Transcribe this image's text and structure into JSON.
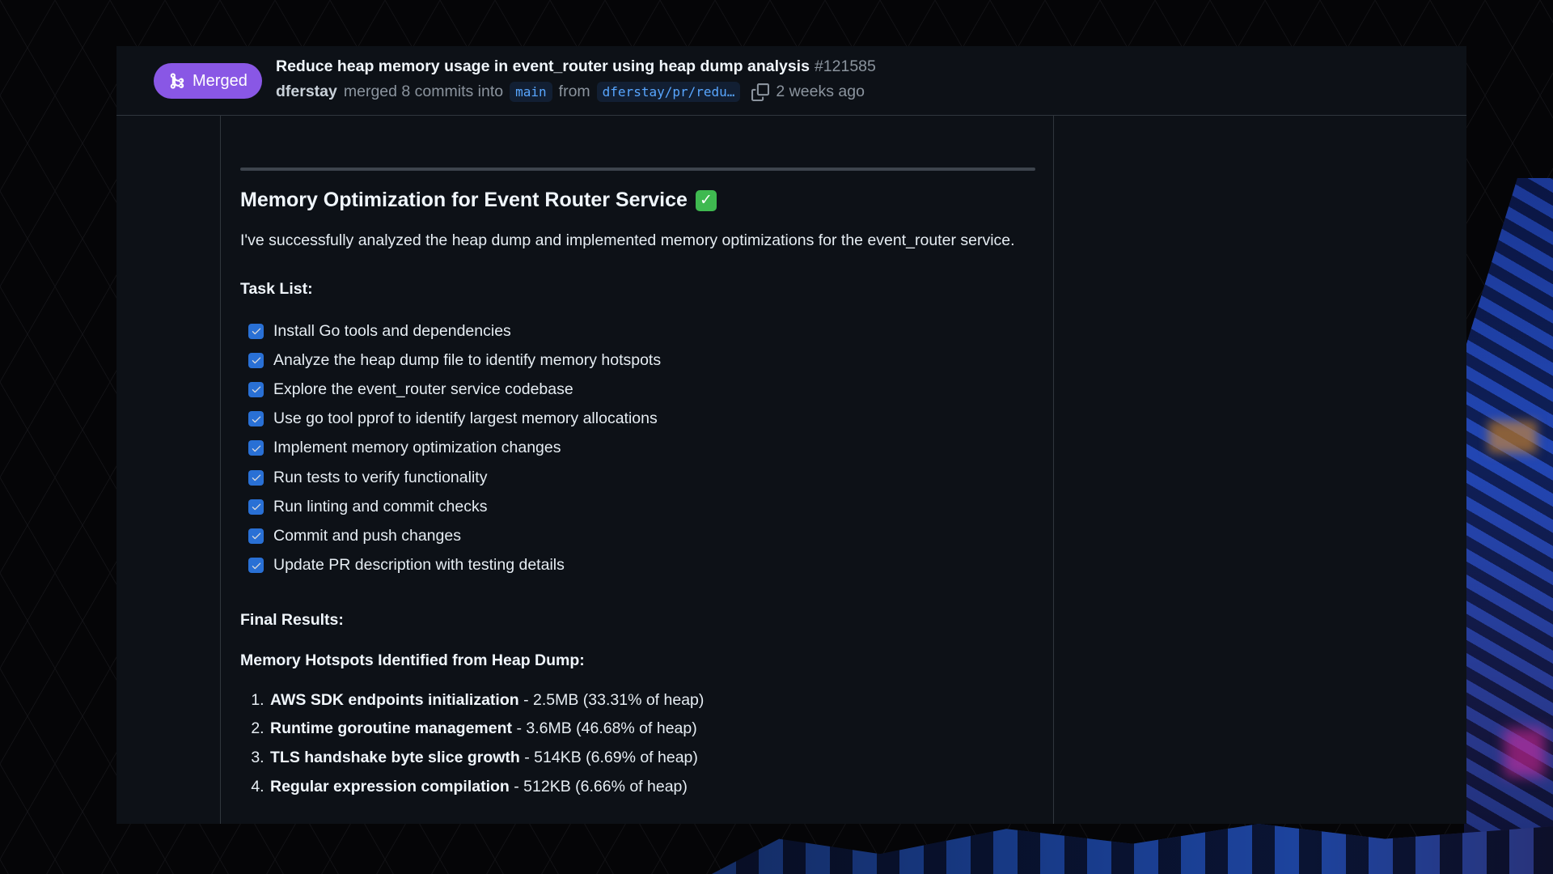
{
  "header": {
    "status_badge": "Merged",
    "title": "Reduce heap memory usage in event_router using heap dump analysis",
    "number": "#121585",
    "author": "dferstay",
    "merge_text": "merged 8 commits into",
    "base_branch": "main",
    "from_text": "from",
    "head_branch": "dferstay/pr/redu…",
    "time": "2 weeks ago"
  },
  "body": {
    "heading": "Memory Optimization for Event Router Service",
    "intro": "I've successfully analyzed the heap dump and implemented memory optimizations for the event_router service.",
    "task_list_title": "Task List:",
    "tasks": [
      "Install Go tools and dependencies",
      "Analyze the heap dump file to identify memory hotspots",
      "Explore the event_router service codebase",
      "Use go tool pprof to identify largest memory allocations",
      "Implement memory optimization changes",
      "Run tests to verify functionality",
      "Run linting and commit checks",
      "Commit and push changes",
      "Update PR description with testing details"
    ],
    "final_results_title": "Final Results:",
    "hotspots_title": "Memory Hotspots Identified from Heap Dump:",
    "hotspots": [
      {
        "name": "AWS SDK endpoints initialization",
        "detail": " - 2.5MB (33.31% of heap)"
      },
      {
        "name": "Runtime goroutine management",
        "detail": " - 3.6MB (46.68% of heap)"
      },
      {
        "name": "TLS handshake byte slice growth",
        "detail": " - 514KB (6.69% of heap)"
      },
      {
        "name": "Regular expression compilation",
        "detail": " - 512KB (6.66% of heap)"
      }
    ]
  },
  "colors": {
    "merged": "#8957e5",
    "background": "#0d1117",
    "checkbox": "#2f81f7",
    "link": "#58a6ff"
  }
}
